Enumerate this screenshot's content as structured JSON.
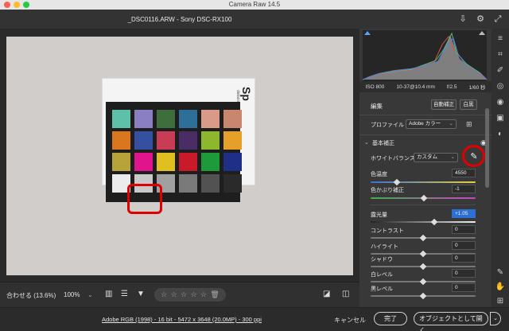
{
  "window": {
    "title": "Camera Raw 14.5",
    "file_info": "_DSC0116.ARW  -  Sony DSC-RX100"
  },
  "colors": {
    "accent_red": "#e00000",
    "highlight_blue": "#2d6fd3"
  },
  "header_icons": [
    "save-icon",
    "gear-icon",
    "fullscreen-icon"
  ],
  "exif": {
    "iso": "ISO 800",
    "focal": "10-37@10.4 mm",
    "aperture": "f/2.5",
    "shutter": "1/60 秒"
  },
  "edit": {
    "title": "編集",
    "auto_label": "自動補正",
    "bw_label": "白黒"
  },
  "profile": {
    "label": "プロファイル",
    "value": "Adobe カラー"
  },
  "basic": {
    "title": "基本補正",
    "wb_label": "ホワイトバランス",
    "wb_value": "カスタム",
    "temperature_label": "色温度",
    "temperature_value": "4550",
    "tint_label": "色かぶり補正",
    "tint_value": "-1",
    "exposure_label": "露光量",
    "exposure_value": "+1.05",
    "contrast_label": "コントラスト",
    "contrast_value": "0",
    "highlights_label": "ハイライト",
    "highlights_value": "0",
    "shadows_label": "シャドウ",
    "shadows_value": "0",
    "whites_label": "白レベル",
    "whites_value": "0",
    "blacks_label": "黒レベル",
    "blacks_value": "0"
  },
  "bottombar": {
    "fit_label": "合わせる (13.6%)",
    "zoom_label": "100%",
    "stars": [
      "☆",
      "☆",
      "☆",
      "☆",
      "☆"
    ]
  },
  "footer": {
    "workflow_info": "Adobe RGB (1998) - 16 bit - 5472 x 3648 (20.0MP) - 300 ppi",
    "cancel_label": "キャンセル",
    "done_label": "完了",
    "open_label": "オブジェクトとして開く"
  },
  "checker_colors": [
    "#5ec0a8",
    "#8a7fc0",
    "#3e6e3c",
    "#2e6f9a",
    "#d99a8a",
    "#c8866e",
    "#d9761e",
    "#3550a0",
    "#c83c55",
    "#4a2c66",
    "#8db82e",
    "#e6a02a",
    "#b8a33a",
    "#e0158e",
    "#e0c020",
    "#c81a2a",
    "#1f9a3a",
    "#1f2e86",
    "#ececec",
    "#c9c9c9",
    "#a0a0a0",
    "#7a7a7a",
    "#525252",
    "#2a2a2a"
  ],
  "card_text": {
    "brand": "Sp",
    "small": "datacolor"
  }
}
